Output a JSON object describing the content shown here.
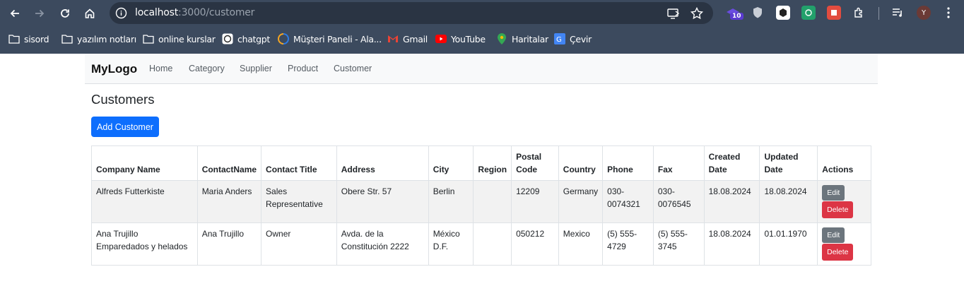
{
  "browser": {
    "url_host": "localhost",
    "url_path": ":3000/customer",
    "extension_badge": "10",
    "profile_initial": "Y"
  },
  "bookmarks": [
    {
      "label": "sisord",
      "icon": "folder-icon"
    },
    {
      "label": "yazılım notları",
      "icon": "folder-icon"
    },
    {
      "label": "online kurslar",
      "icon": "folder-icon"
    },
    {
      "label": "chatgpt",
      "icon": "chatgpt-icon"
    },
    {
      "label": "Müşteri Paneli - Ala...",
      "icon": "site-icon"
    },
    {
      "label": "Gmail",
      "icon": "gmail-icon"
    },
    {
      "label": "YouTube",
      "icon": "youtube-icon"
    },
    {
      "label": "Haritalar",
      "icon": "maps-icon"
    },
    {
      "label": "Çevir",
      "icon": "translate-icon"
    }
  ],
  "navbar": {
    "brand": "MyLogo",
    "links": [
      "Home",
      "Category",
      "Supplier",
      "Product",
      "Customer"
    ]
  },
  "page": {
    "title": "Customers",
    "add_button": "Add Customer"
  },
  "table": {
    "headers": [
      "Company Name",
      "ContactName",
      "Contact Title",
      "Address",
      "City",
      "Region",
      "Postal Code",
      "Country",
      "Phone",
      "Fax",
      "Created Date",
      "Updated Date",
      "Actions"
    ],
    "rows": [
      [
        "Alfreds Futterkiste",
        "Maria Anders",
        "Sales Representative",
        "Obere Str. 57",
        "Berlin",
        "",
        "12209",
        "Germany",
        "030-0074321",
        "030-0076545",
        "18.08.2024",
        "18.08.2024"
      ],
      [
        "Ana Trujillo Emparedados y helados",
        "Ana Trujillo",
        "Owner",
        "Avda. de la Constitución 2222",
        "México D.F.",
        "",
        "050212",
        "Mexico",
        "(5) 555-4729",
        "(5) 555-3745",
        "18.08.2024",
        "01.01.1970"
      ]
    ],
    "edit_label": "Edit",
    "delete_label": "Delete"
  },
  "colors": {
    "chrome": "#3c4a5e",
    "primary": "#0d6efd",
    "secondary": "#6c757d",
    "danger": "#dc3545"
  }
}
